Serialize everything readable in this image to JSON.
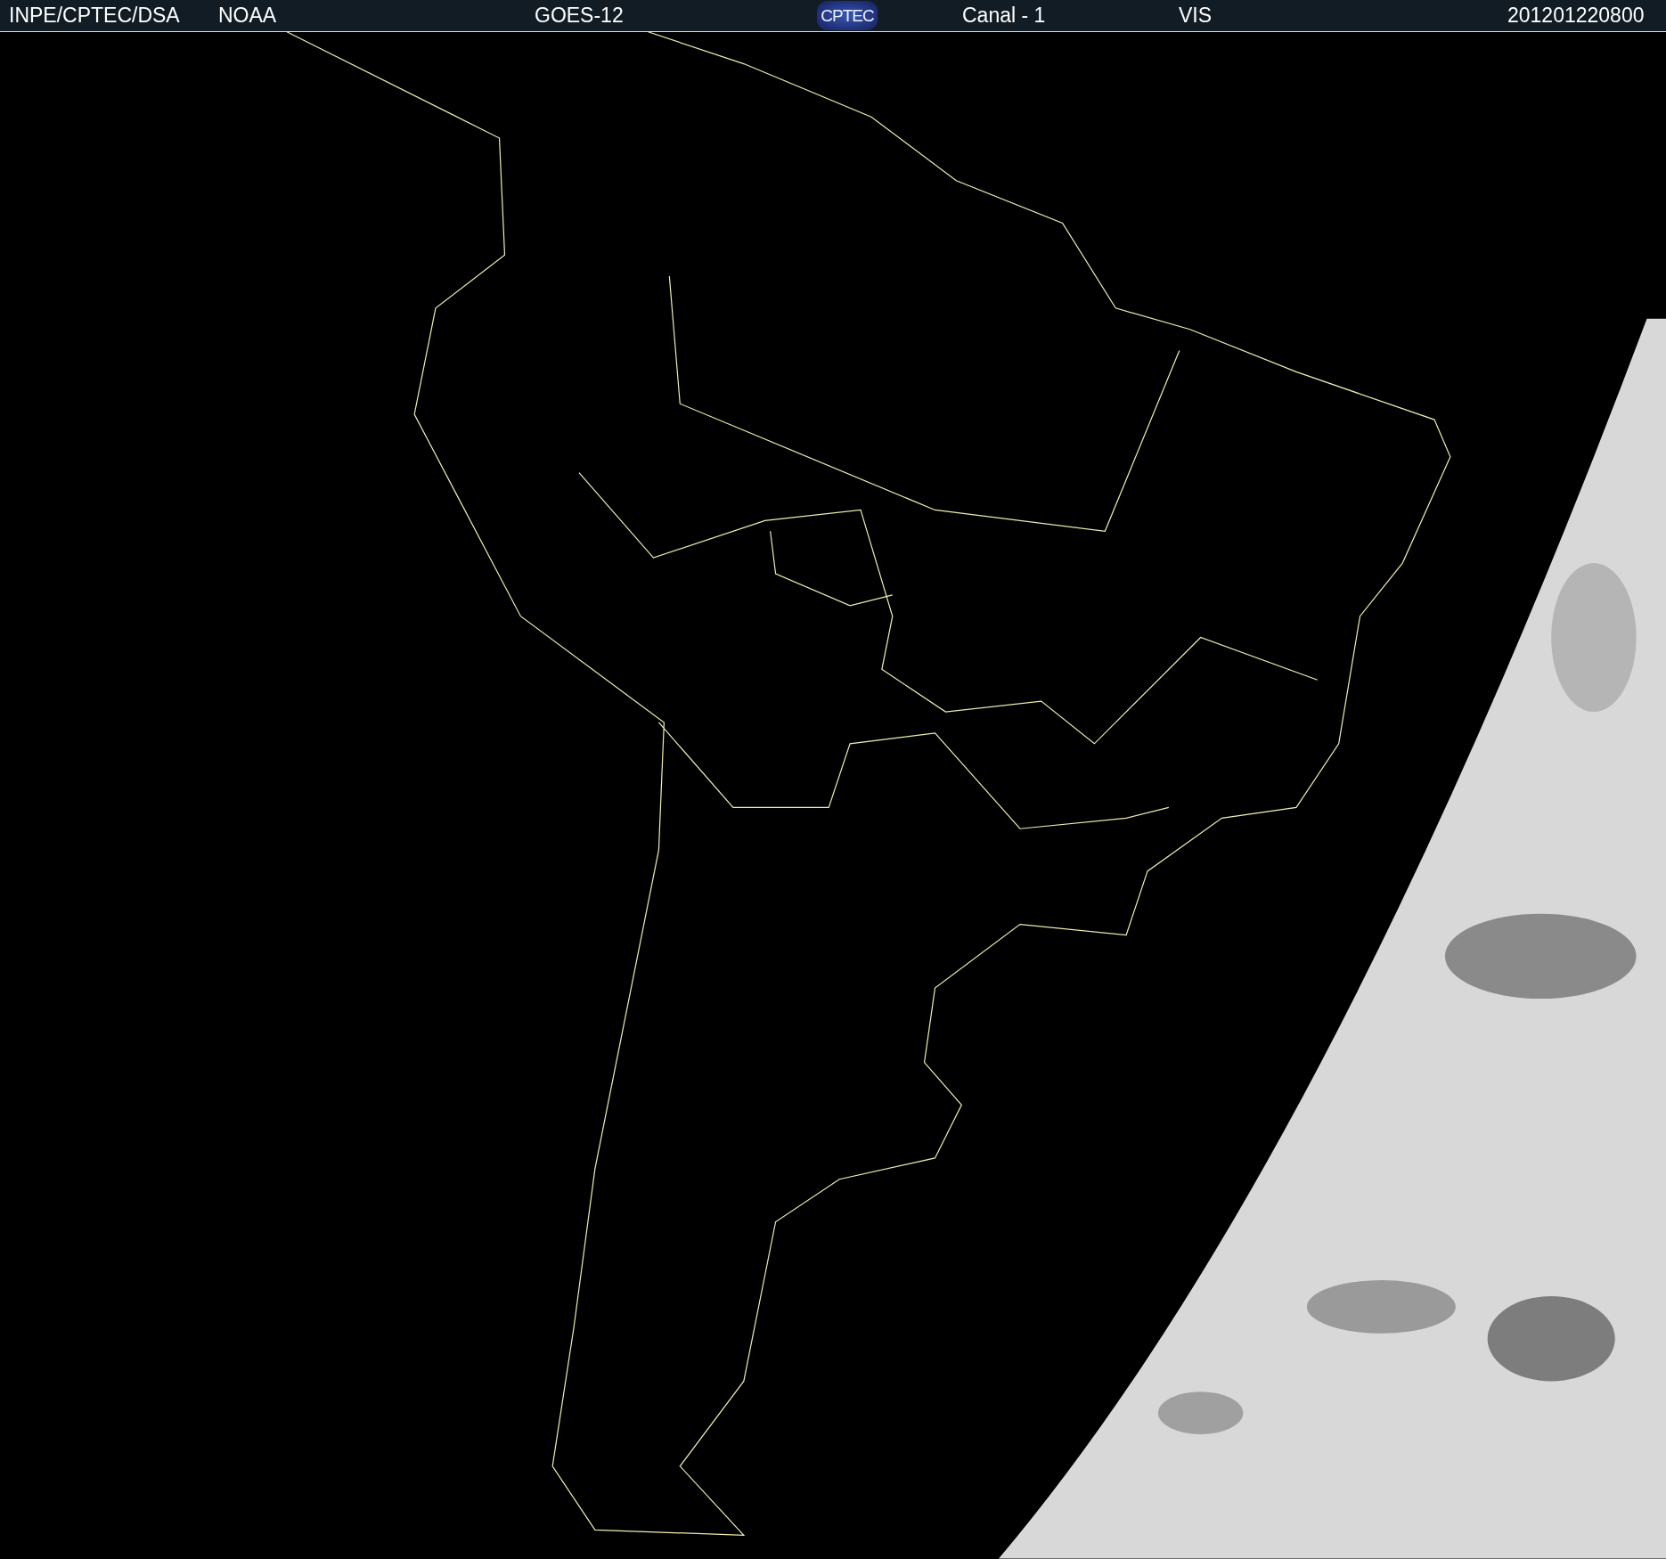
{
  "header": {
    "agency": "INPE/CPTEC/DSA",
    "source": "NOAA",
    "satellite": "GOES-12",
    "logo": "CPTEC",
    "channel": "Canal - 1",
    "band": "VIS",
    "timestamp": "201201220800"
  }
}
